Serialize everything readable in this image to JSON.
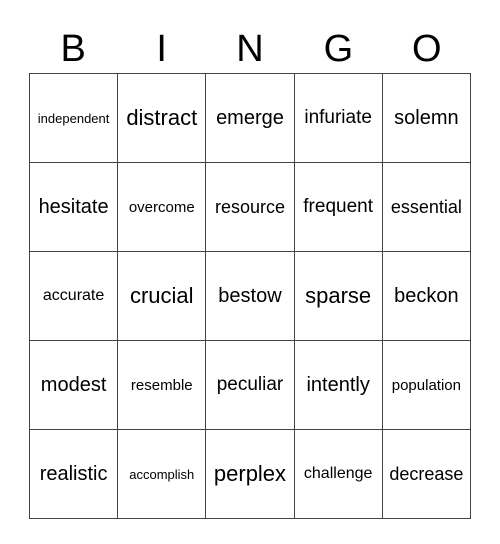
{
  "header": [
    "B",
    "I",
    "N",
    "G",
    "O"
  ],
  "rows": [
    [
      "independent",
      "distract",
      "emerge",
      "infuriate",
      "solemn"
    ],
    [
      "hesitate",
      "overcome",
      "resource",
      "frequent",
      "essential"
    ],
    [
      "accurate",
      "crucial",
      "bestow",
      "sparse",
      "beckon"
    ],
    [
      "modest",
      "resemble",
      "peculiar",
      "intently",
      "population"
    ],
    [
      "realistic",
      "accomplish",
      "perplex",
      "challenge",
      "decrease"
    ]
  ]
}
